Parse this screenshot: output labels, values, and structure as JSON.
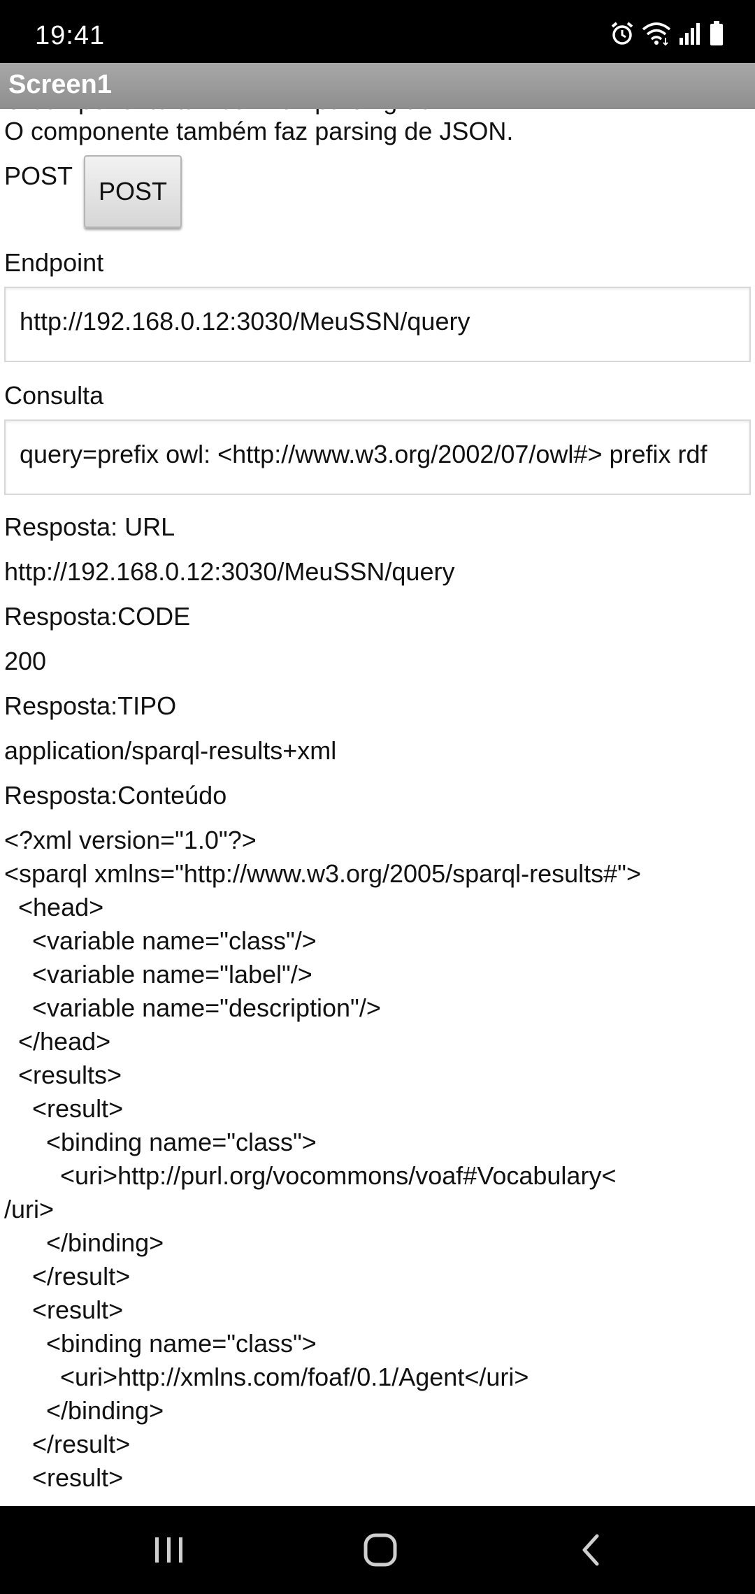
{
  "status_bar": {
    "time": "19:41",
    "icons": [
      "alarm-icon",
      "wifi-icon",
      "signal-icon",
      "battery-icon"
    ]
  },
  "app": {
    "title": "Screen1"
  },
  "content": {
    "cut_text": "O componente também faz parsing de XML.",
    "intro": "O componente também faz parsing de JSON.",
    "post_label": "POST",
    "post_button": "POST",
    "endpoint_label": "Endpoint",
    "endpoint_value": "http://192.168.0.12:3030/MeuSSN/query",
    "consulta_label": "Consulta",
    "consulta_value": "query=prefix owl: <http://www.w3.org/2002/07/owl#> prefix rdf",
    "resp_url_label": "Resposta: URL",
    "resp_url_value": "http://192.168.0.12:3030/MeuSSN/query",
    "resp_code_label": "Resposta:CODE",
    "resp_code_value": "200",
    "resp_tipo_label": "Resposta:TIPO",
    "resp_tipo_value": "application/sparql-results+xml",
    "resp_conteudo_label": "Resposta:Conteúdo",
    "xml_lines": [
      "<?xml version=\"1.0\"?>",
      "<sparql xmlns=\"http://www.w3.org/2005/sparql-results#\">",
      "  <head>",
      "    <variable name=\"class\"/>",
      "    <variable name=\"label\"/>",
      "    <variable name=\"description\"/>",
      "  </head>",
      "  <results>",
      "    <result>",
      "      <binding name=\"class\">",
      "        <uri>http://purl.org/vocommons/voaf#Vocabulary<",
      "/uri>",
      "      </binding>",
      "    </result>",
      "    <result>",
      "      <binding name=\"class\">",
      "        <uri>http://xmlns.com/foaf/0.1/Agent</uri>",
      "      </binding>",
      "    </result>",
      "    <result>"
    ]
  },
  "nav_bar": {
    "buttons": [
      "recent-apps-icon",
      "home-icon",
      "back-icon"
    ]
  },
  "colors": {
    "status_bg": "#000000",
    "title_bar": "#9a9a9a",
    "button_bg": "#e4e4e4",
    "field_border": "#d8d8d8"
  }
}
